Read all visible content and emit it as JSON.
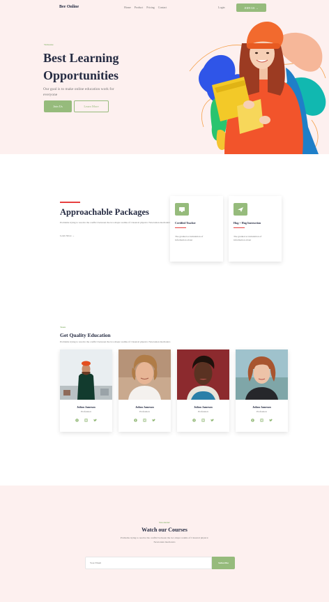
{
  "nav": {
    "brand": "Bee Online",
    "menu": [
      "Home",
      "Product",
      "Pricing",
      "Contact"
    ],
    "login": "Login",
    "join": "JOIN US →"
  },
  "hero": {
    "tag": "Welcome",
    "title": "Best Learning Opportunities",
    "description": "Our goal is to make online education work for everyone",
    "primary_button": "Join Us",
    "secondary_button": "Learn More"
  },
  "packages": {
    "title": "Approachable Packages",
    "description": "Problems trying to resolve the conflict between the two major realms of Classical physics: Newtonian mechanics",
    "link": "Learn More  →",
    "cards": [
      {
        "icon": "monitor-icon",
        "title": "Certified Teacher",
        "description": "The gradual accumulation of information about"
      },
      {
        "icon": "paper-plane-icon",
        "title": "Hug + Hug Instruction",
        "description": "The gradual accumulation of information about"
      }
    ]
  },
  "team": {
    "tag": "Team",
    "title": "Get Quality Education",
    "description": "Problems trying to resolve the conflict between the two major realms of Classical physics: Newtonian mechanics",
    "members": [
      {
        "name": "Julian Jameson",
        "role": "Profession"
      },
      {
        "name": "Julian Jameson",
        "role": "Profession"
      },
      {
        "name": "Julian Jameson",
        "role": "Profession"
      },
      {
        "name": "Julian Jameson",
        "role": "Profession"
      }
    ],
    "social_icons": [
      "facebook-icon",
      "instagram-icon",
      "twitter-icon"
    ]
  },
  "cta": {
    "tag": "Newsletter",
    "title": "Watch our Courses",
    "description": "Problems trying to resolve the conflict between the two major realms of Classical physics: Newtonian mechanics",
    "input_placeholder": "Your Email",
    "button": "Subscribe"
  },
  "colors": {
    "accent": "#96BB7C",
    "heading": "#252B42",
    "muted": "#737373",
    "danger_line": "#E74040",
    "hero_bg": "#FDF0EF"
  }
}
